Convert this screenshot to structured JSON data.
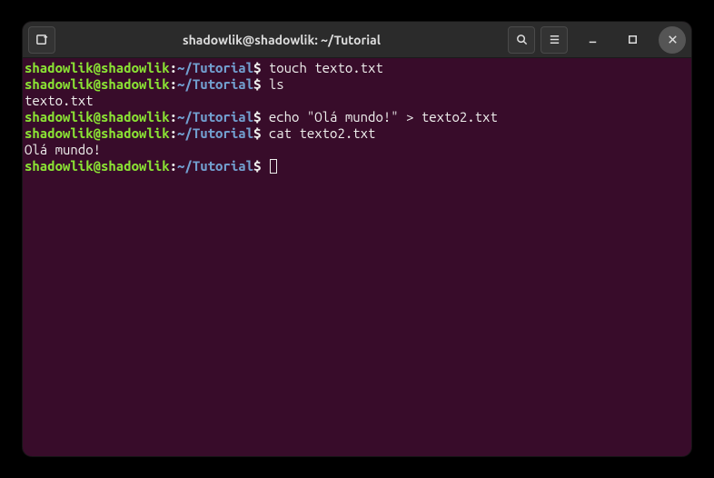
{
  "window": {
    "title": "shadowlik@shadowlik: ~/Tutorial"
  },
  "prompt": {
    "user_host": "shadowlik@shadowlik",
    "separator": ":",
    "path": "~/Tutorial",
    "dollar": "$"
  },
  "session": {
    "lines": [
      {
        "type": "cmd",
        "command": " touch texto.txt"
      },
      {
        "type": "cmd",
        "command": " ls"
      },
      {
        "type": "out",
        "text": "texto.txt"
      },
      {
        "type": "cmd",
        "command": " echo \"Olá mundo!\" > texto2.txt"
      },
      {
        "type": "cmd",
        "command": " cat texto2.txt"
      },
      {
        "type": "out",
        "text": "Olá mundo!"
      },
      {
        "type": "cmd",
        "command": " ",
        "cursor": true
      }
    ]
  },
  "colors": {
    "bg": "#380c2a",
    "titlebar": "#2b2b2b",
    "user": "#8ae234",
    "path": "#729fcf",
    "fg": "#eeeeec"
  }
}
